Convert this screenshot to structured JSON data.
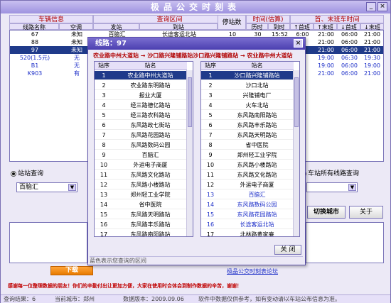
{
  "window": {
    "title": "极品公交时刻表",
    "min": "_",
    "close": "×"
  },
  "headers": {
    "vehicle_info": "车辆信息",
    "route_name": "线路名称",
    "aircon": "空调",
    "query_range": "查询区间",
    "depart": "发站",
    "arrive": "到站",
    "stop_count": "停站数",
    "time_est": "时间(估算)",
    "depart_time": "历时",
    "arrive_time": "到时",
    "first_last": "首、末班车时间",
    "first1": "↑首班",
    "last1": "↑末班",
    "first2": "↓首班",
    "last2": "↓末班"
  },
  "routes": [
    {
      "name": "67",
      "ac": "未知",
      "from": "百脑汇",
      "to": "长途客运北站",
      "stops": "10",
      "t1": "30",
      "t2": "15:52",
      "f1": "6:00",
      "l1": "21:00",
      "f2": "06:00",
      "l2": "21:00"
    },
    {
      "name": "88",
      "ac": "未知",
      "from": "",
      "to": "",
      "stops": "",
      "t1": "",
      "t2": "",
      "f1": "",
      "l1": "21:00",
      "f2": "06:00",
      "l2": "21:00"
    },
    {
      "name": "97",
      "ac": "未知",
      "from": "",
      "to": "",
      "stops": "",
      "t1": "",
      "t2": "",
      "f1": "",
      "l1": "21:00",
      "f2": "06:00",
      "l2": "21:00"
    },
    {
      "name": "520(1.5元)",
      "ac": "无",
      "from": "",
      "to": "",
      "stops": "",
      "t1": "",
      "t2": "",
      "f1": "",
      "l1": "19:00",
      "f2": "06:30",
      "l2": "19:30"
    },
    {
      "name": "B1",
      "ac": "无",
      "from": "",
      "to": "",
      "stops": "",
      "t1": "",
      "t2": "",
      "f1": "",
      "l1": "19:00",
      "f2": "06:00",
      "l2": "19:00"
    },
    {
      "name": "K903",
      "ac": "有",
      "from": "",
      "to": "",
      "stops": "",
      "t1": "",
      "t2": "",
      "f1": "",
      "l1": "21:00",
      "f2": "06:00",
      "l2": "21:00"
    }
  ],
  "query": {
    "station_query_label": "站站查询",
    "station_value": "百脑汇",
    "all_routes_label": "车站所有线路查询",
    "switch_city": "切换城市",
    "about": "关于",
    "download": "下载",
    "forum_link": "极品公交时刻表论坛",
    "thanks": "感谢每一位整理数据的朋友！你们的辛勤付出让更加方便，大家在使用时合体会到制作数据的辛苦，谢谢！"
  },
  "status": {
    "result": "查询结果：6",
    "city": "当前城市：郑州",
    "date": "数据版本：2009.09.06",
    "note": "软件中数据仅供参考，如有变动请以车站公布信息为准。"
  },
  "dialog": {
    "title": "线路：97",
    "close": "×",
    "route_text": "农业路中州大道站 → 沙口路兴隆铺路站沙口路兴隆铺路站 → 农业路中州大道站",
    "col_no": "站序",
    "col_name": "站名",
    "left_stations": [
      "农业路中州大道站",
      "农业路东明路站",
      "报业大厦",
      "经三路德亿路站",
      "经三路农科路站",
      "东风路政七街站",
      "东风路花园路站",
      "东风路数码公园",
      "百脑汇",
      "外运电子商厦",
      "东风路文化路站",
      "东风路小楼路站",
      "郑州轻工业学院",
      "省中医院",
      "东风路天明路站",
      "东风路丰乐路站",
      "东风路南阳路站"
    ],
    "right_stations": [
      "沙口路兴隆铺路站",
      "沙口北站",
      "兴隆铺电厂",
      "火车北站",
      "东风路南阳路站",
      "东风路丰乐路站",
      "东风路天明路站",
      "省中医院",
      "郑州轻工业学院",
      "东风路小楼路站",
      "东风路文化路站",
      "外运电子商厦",
      "百脑汇",
      "东风路数码公园",
      "东风路花园路站",
      "长途客运北站",
      "北林路黄家庵"
    ],
    "legend": "蓝色表示您查询的区间",
    "close_btn": "关 闭"
  },
  "colors": {
    "accent": "#1f3a8a",
    "highlight_red": "#b00000",
    "query_blue": "#1c2ec8"
  }
}
